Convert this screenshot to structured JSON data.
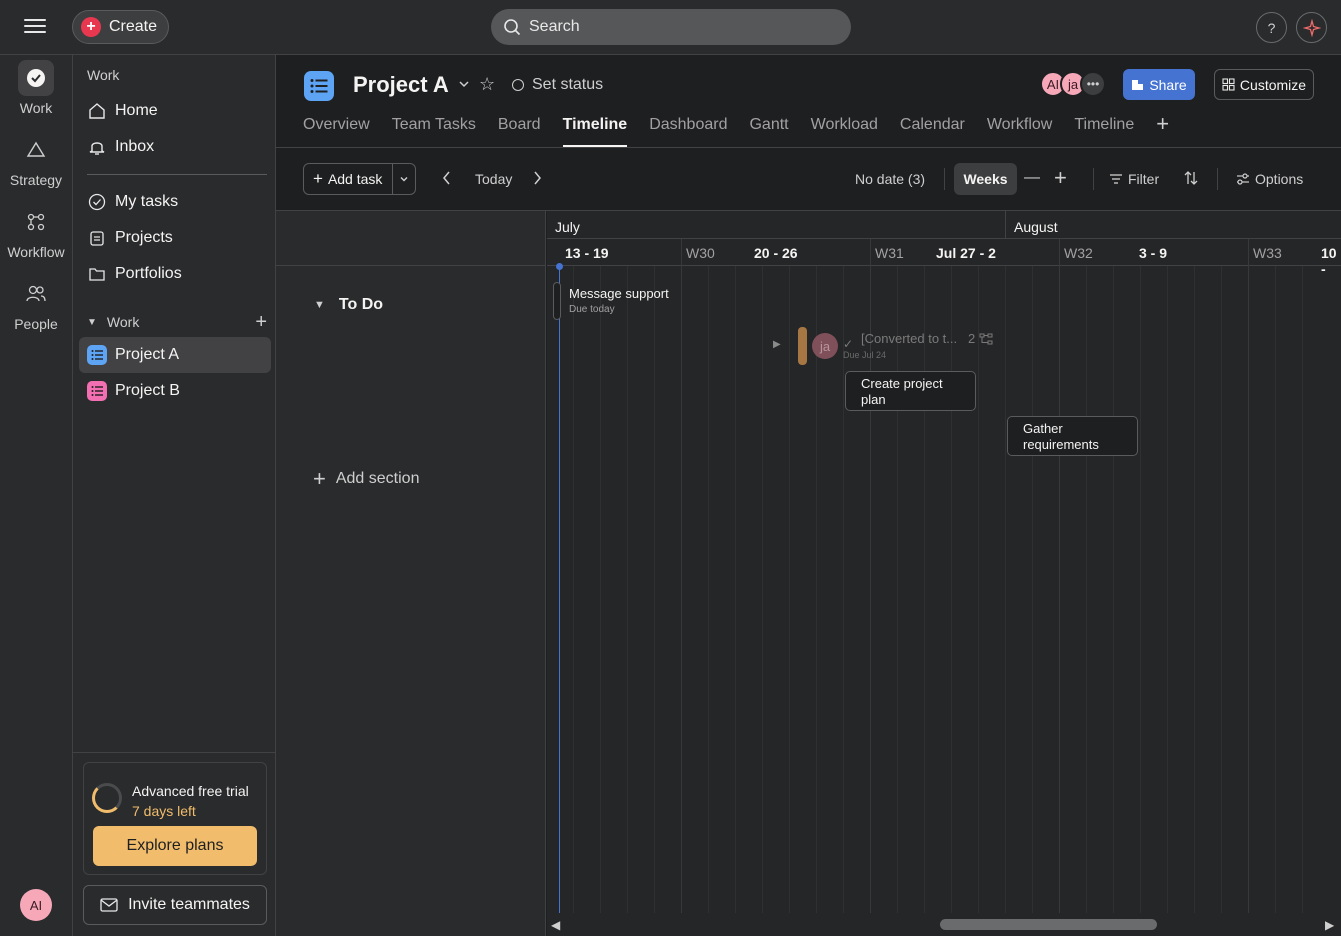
{
  "topbar": {
    "create_label": "Create",
    "search_placeholder": "Search",
    "help_label": "?"
  },
  "rail": {
    "items": [
      {
        "label": "Work",
        "icon": "check-circle-icon"
      },
      {
        "label": "Strategy",
        "icon": "triangle-icon"
      },
      {
        "label": "Workflow",
        "icon": "workflow-icon"
      },
      {
        "label": "People",
        "icon": "people-icon"
      }
    ],
    "user_initials": "AI"
  },
  "sidebar": {
    "heading": "Work",
    "top_items": [
      {
        "label": "Home",
        "icon": "home-icon"
      },
      {
        "label": "Inbox",
        "icon": "bell-icon"
      }
    ],
    "mid_items": [
      {
        "label": "My tasks",
        "icon": "check-circle-icon"
      },
      {
        "label": "Projects",
        "icon": "clipboard-icon"
      },
      {
        "label": "Portfolios",
        "icon": "folder-icon"
      }
    ],
    "section_label": "Work",
    "projects": [
      {
        "label": "Project A",
        "color": "#5ea4f5"
      },
      {
        "label": "Project B",
        "color": "#f26fb2"
      }
    ],
    "trial": {
      "title": "Advanced free trial",
      "sub": "7 days left",
      "explore_label": "Explore plans"
    },
    "invite_label": "Invite teammates"
  },
  "project": {
    "title": "Project A",
    "set_status": "Set status",
    "avatars": [
      "AI",
      "ja"
    ],
    "share_label": "Share",
    "customize_label": "Customize",
    "tabs": [
      "Overview",
      "Team Tasks",
      "Board",
      "Timeline",
      "Dashboard",
      "Gantt",
      "Workload",
      "Calendar",
      "Workflow",
      "Timeline"
    ],
    "active_tab": 3
  },
  "toolbar": {
    "add_task_label": "Add task",
    "today_label": "Today",
    "no_date_label": "No date (3)",
    "weeks_label": "Weeks",
    "filter_label": "Filter",
    "options_label": "Options"
  },
  "timeline": {
    "section_name": "To Do",
    "add_section_label": "Add section",
    "months": [
      "July",
      "August"
    ],
    "weeks": [
      "13 - 19",
      "W30",
      "20 - 26",
      "W31",
      "Jul 27 - 2",
      "W32",
      "3 - 9",
      "W33",
      "10 -"
    ],
    "tasks": {
      "message_support": {
        "title": "Message support",
        "due": "Due today"
      },
      "converted": {
        "title": "[Converted to t...",
        "count": "2",
        "due": "Due Jul 24",
        "assignee": "ja"
      },
      "create_plan": {
        "title": "Create project plan"
      },
      "gather_req": {
        "title": "Gather requirements"
      }
    }
  }
}
